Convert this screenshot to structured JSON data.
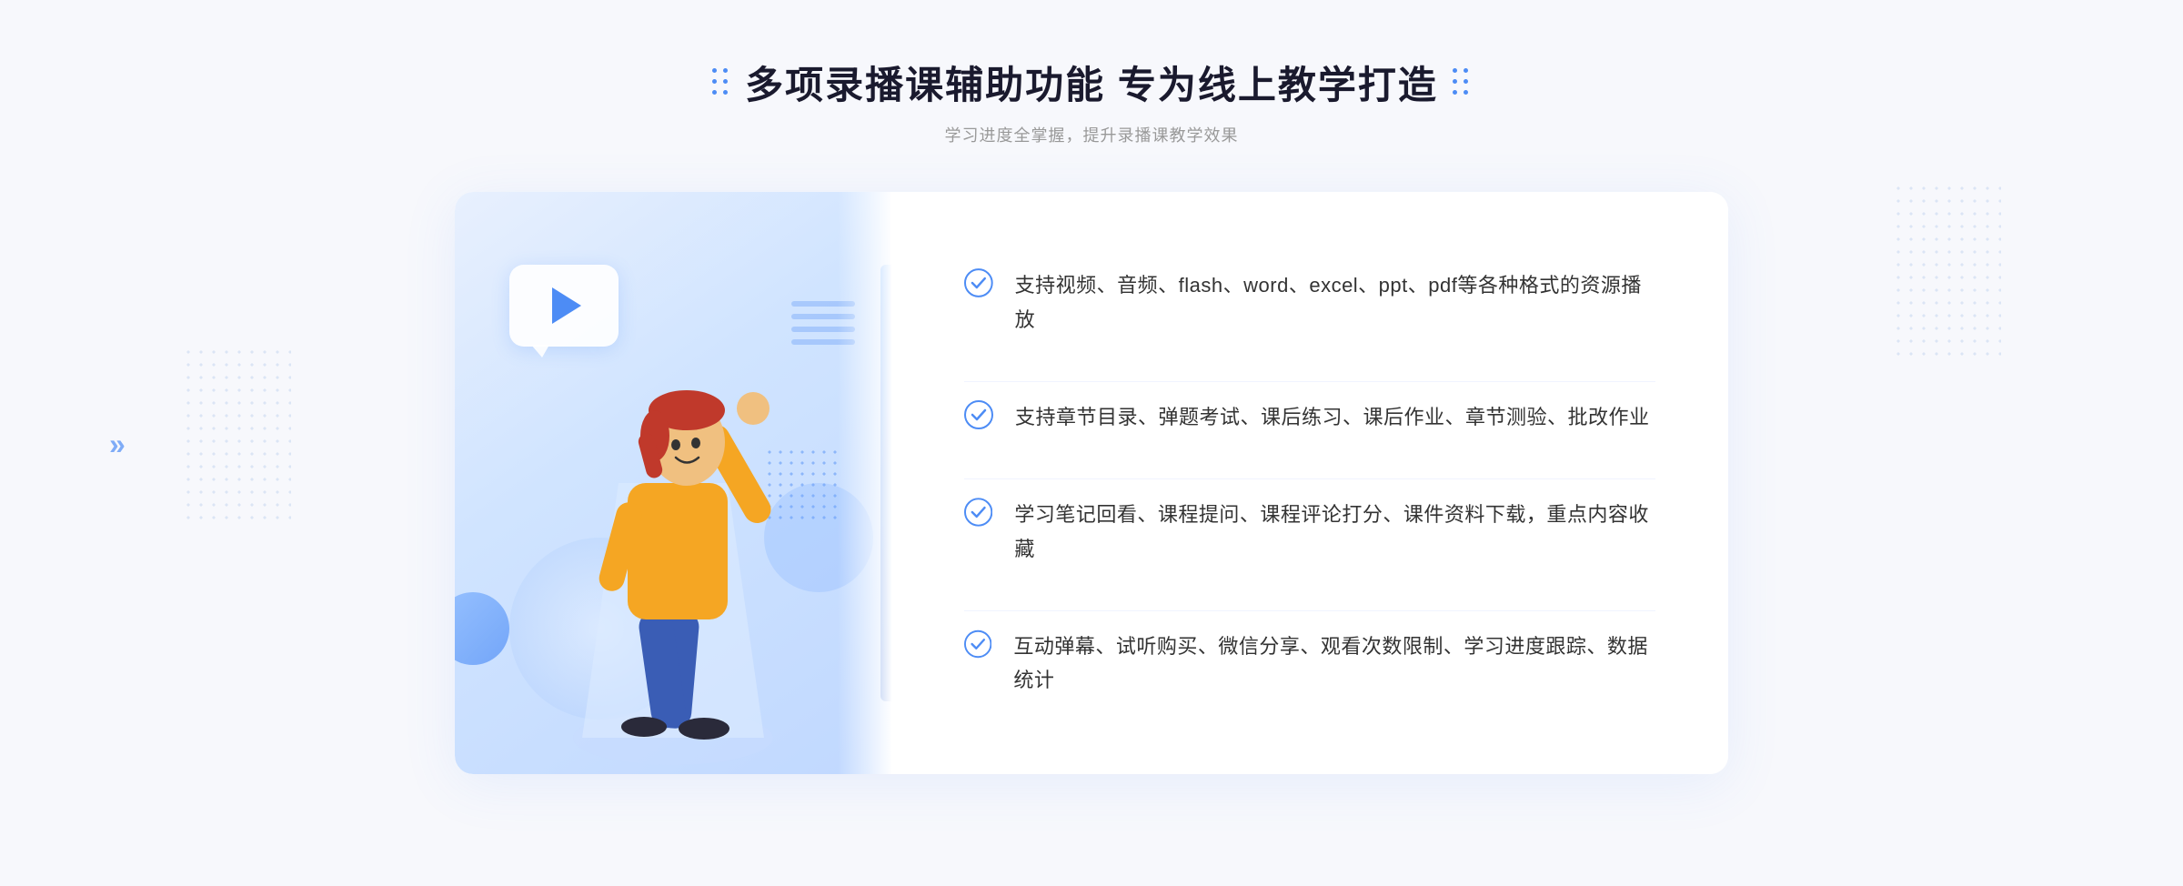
{
  "header": {
    "title": "多项录播课辅助功能 专为线上教学打造",
    "subtitle": "学习进度全掌握，提升录播课教学效果"
  },
  "features": [
    {
      "id": "feature-1",
      "text": "支持视频、音频、flash、word、excel、ppt、pdf等各种格式的资源播放"
    },
    {
      "id": "feature-2",
      "text": "支持章节目录、弹题考试、课后练习、课后作业、章节测验、批改作业"
    },
    {
      "id": "feature-3",
      "text": "学习笔记回看、课程提问、课程评论打分、课件资料下载，重点内容收藏"
    },
    {
      "id": "feature-4",
      "text": "互动弹幕、试听购买、微信分享、观看次数限制、学习进度跟踪、数据统计"
    }
  ],
  "colors": {
    "primary": "#4d8cf5",
    "title": "#1a1a2e",
    "subtitle": "#999999",
    "feature_text": "#333333",
    "bg": "#f7f8fc"
  }
}
